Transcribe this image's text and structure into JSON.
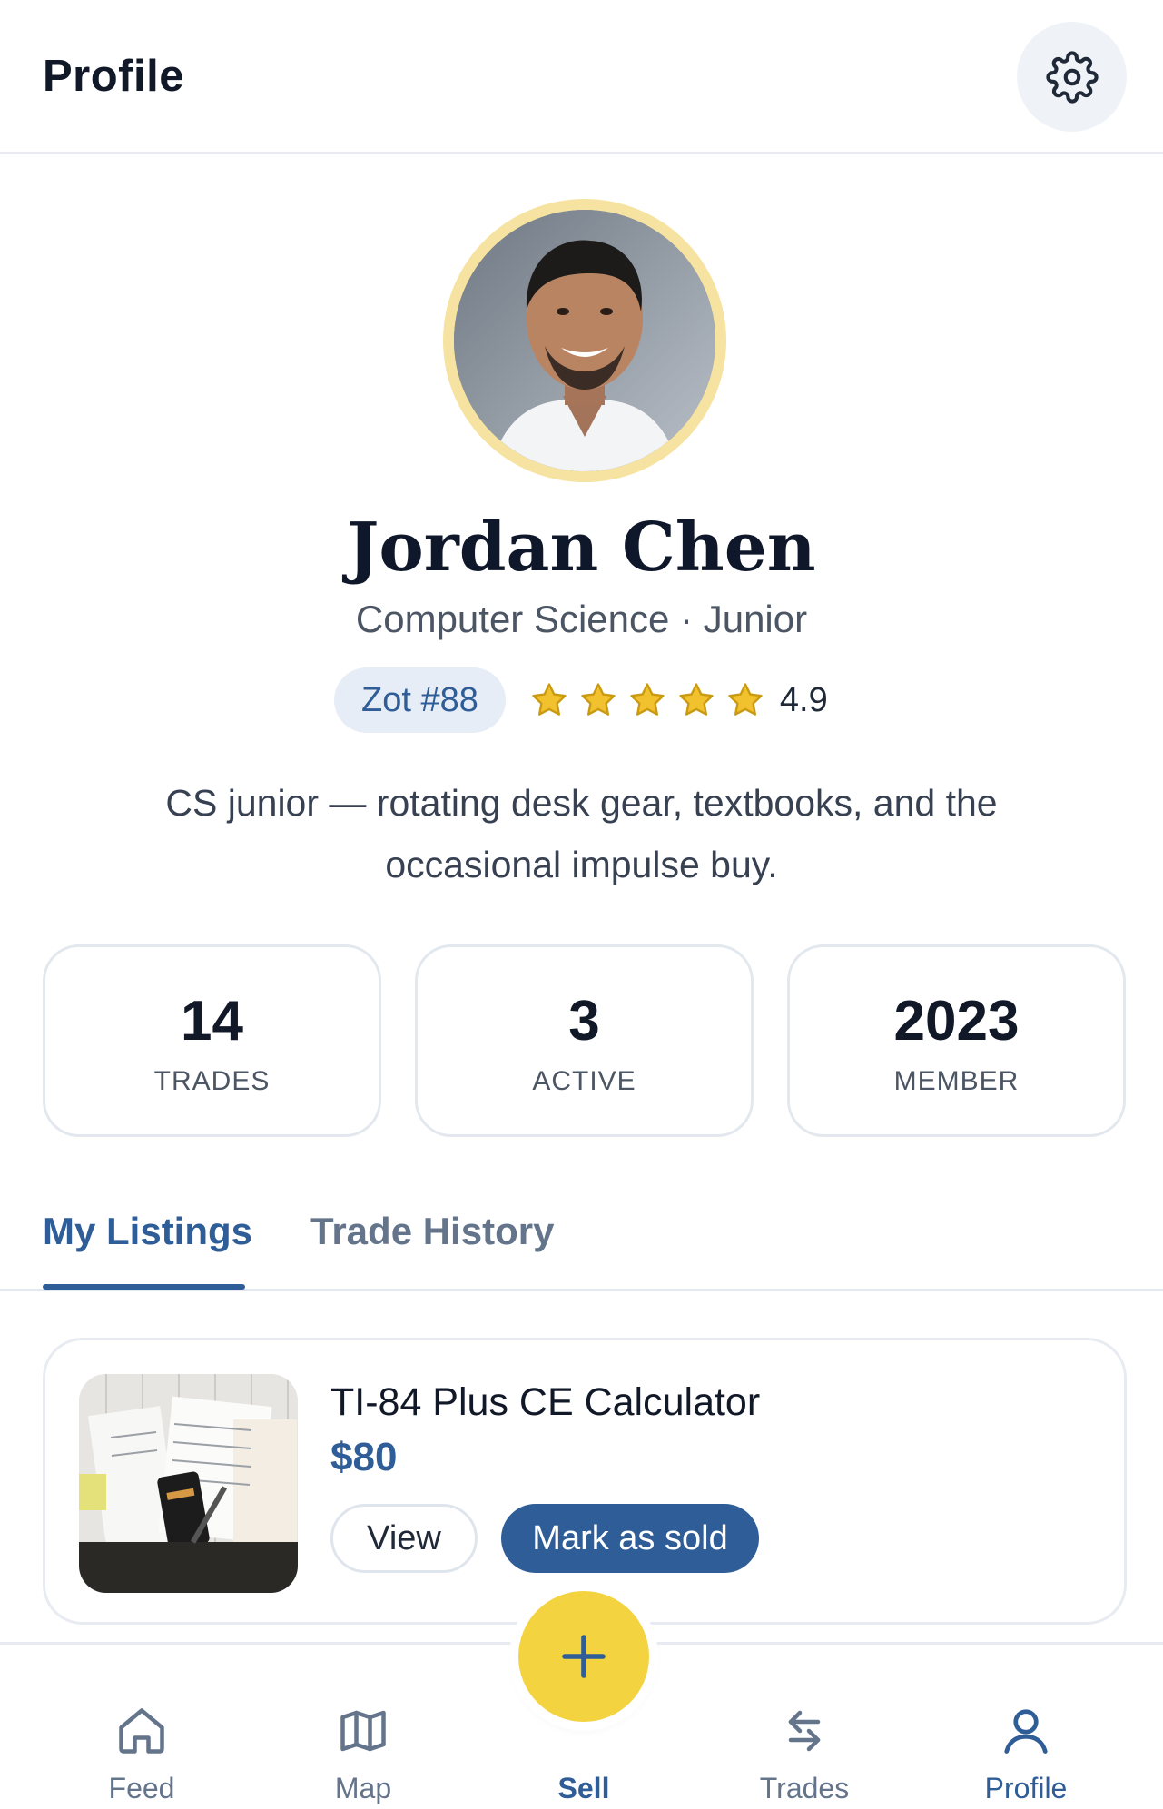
{
  "header": {
    "title": "Profile",
    "settings_icon": "gear-icon"
  },
  "profile": {
    "avatar_icon": "user-photo",
    "name": "Jordan Chen",
    "subtitle": "Computer Science · Junior",
    "badge": "Zot #88",
    "rating_stars": 5,
    "rating": "4.9",
    "bio": "CS junior — rotating desk gear, textbooks, and the occasional impulse buy."
  },
  "stats": [
    {
      "value": "14",
      "label": "TRADES"
    },
    {
      "value": "3",
      "label": "ACTIVE"
    },
    {
      "value": "2023",
      "label": "MEMBER"
    }
  ],
  "tabs": {
    "active": "My Listings",
    "inactive": "Trade History"
  },
  "listing": {
    "title": "TI-84 Plus CE Calculator",
    "price": "$80",
    "view_label": "View",
    "sold_label": "Mark as sold"
  },
  "nav": {
    "feed": "Feed",
    "map": "Map",
    "sell": "Sell",
    "trades": "Trades",
    "profile": "Profile"
  },
  "colors": {
    "accent": "#2f5d97",
    "star": "#f2c12e",
    "fab": "#f4d341",
    "avatar_ring": "#f6e3a1"
  }
}
